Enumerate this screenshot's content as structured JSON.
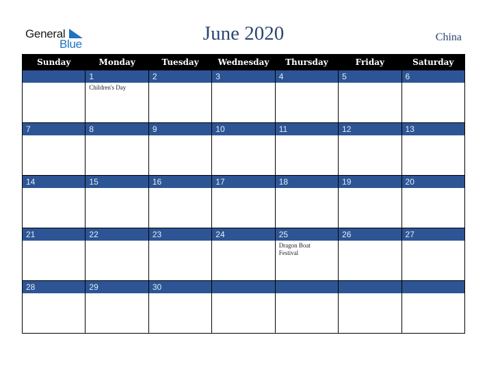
{
  "logo": {
    "word1": "General",
    "word2": "Blue"
  },
  "header": {
    "title": "June 2020",
    "country": "China"
  },
  "colors": {
    "band": "#2d5595",
    "title": "#2c4572",
    "header_bg": "#000000",
    "logo_blue": "#1f73c0"
  },
  "weekdays": [
    "Sunday",
    "Monday",
    "Tuesday",
    "Wednesday",
    "Thursday",
    "Friday",
    "Saturday"
  ],
  "weeks": [
    [
      {
        "day": "",
        "event": ""
      },
      {
        "day": "1",
        "event": "Children's Day"
      },
      {
        "day": "2",
        "event": ""
      },
      {
        "day": "3",
        "event": ""
      },
      {
        "day": "4",
        "event": ""
      },
      {
        "day": "5",
        "event": ""
      },
      {
        "day": "6",
        "event": ""
      }
    ],
    [
      {
        "day": "7",
        "event": ""
      },
      {
        "day": "8",
        "event": ""
      },
      {
        "day": "9",
        "event": ""
      },
      {
        "day": "10",
        "event": ""
      },
      {
        "day": "11",
        "event": ""
      },
      {
        "day": "12",
        "event": ""
      },
      {
        "day": "13",
        "event": ""
      }
    ],
    [
      {
        "day": "14",
        "event": ""
      },
      {
        "day": "15",
        "event": ""
      },
      {
        "day": "16",
        "event": ""
      },
      {
        "day": "17",
        "event": ""
      },
      {
        "day": "18",
        "event": ""
      },
      {
        "day": "19",
        "event": ""
      },
      {
        "day": "20",
        "event": ""
      }
    ],
    [
      {
        "day": "21",
        "event": ""
      },
      {
        "day": "22",
        "event": ""
      },
      {
        "day": "23",
        "event": ""
      },
      {
        "day": "24",
        "event": ""
      },
      {
        "day": "25",
        "event": "Dragon Boat Festival"
      },
      {
        "day": "26",
        "event": ""
      },
      {
        "day": "27",
        "event": ""
      }
    ],
    [
      {
        "day": "28",
        "event": ""
      },
      {
        "day": "29",
        "event": ""
      },
      {
        "day": "30",
        "event": ""
      },
      {
        "day": "",
        "event": ""
      },
      {
        "day": "",
        "event": ""
      },
      {
        "day": "",
        "event": ""
      },
      {
        "day": "",
        "event": ""
      }
    ]
  ]
}
